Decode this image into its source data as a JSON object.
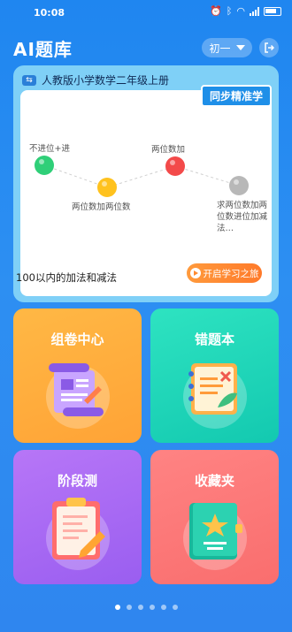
{
  "status_bar": {
    "time": "10:08"
  },
  "header": {
    "title": "AI题库",
    "grade": "初一"
  },
  "course": {
    "title": "人教版小学数学二年级上册",
    "badge": "同步精准学",
    "nodes": [
      {
        "label": "不进位+进",
        "color": "#2fcf78"
      },
      {
        "label": "两位数加两位数",
        "color": "#ffc21e"
      },
      {
        "label": "两位数加",
        "color": "#f34a4a"
      },
      {
        "label": "求两位数加两位数进位加减法…",
        "color": "#b8b8b8"
      }
    ],
    "footer": "100以内的加法和减法",
    "start_label": "开启学习之旅"
  },
  "tiles": [
    {
      "label": "组卷中心",
      "icon": "scroll-paper-icon",
      "color": "#ffae3d"
    },
    {
      "label": "错题本",
      "icon": "notebook-wrong-icon",
      "color": "#1fd5b8"
    },
    {
      "label": "阶段测",
      "icon": "clipboard-test-icon",
      "color": "#a767f3"
    },
    {
      "label": "收藏夹",
      "icon": "star-book-icon",
      "color": "#fb7878"
    }
  ],
  "pager": {
    "count": 6,
    "active": 0
  }
}
